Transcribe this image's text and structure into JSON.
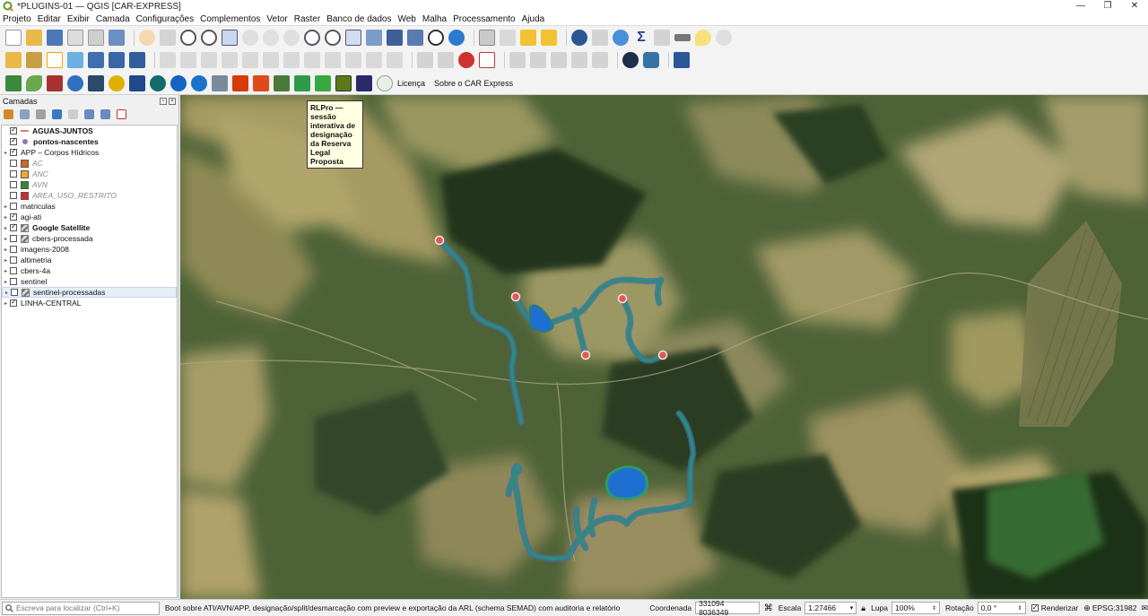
{
  "window": {
    "title": "*PLUGINS-01 — QGIS [CAR-EXPRESS]",
    "controls": [
      "—",
      "❐",
      "✕"
    ]
  },
  "menu": [
    "Projeto",
    "Editar",
    "Exibir",
    "Camada",
    "Configurações",
    "Complementos",
    "Vetor",
    "Raster",
    "Banco de dados",
    "Web",
    "Malha",
    "Processamento",
    "Ajuda"
  ],
  "plugin_toolbar": {
    "license_label": "Licença",
    "about_label": "Sobre o CAR Express"
  },
  "tooltip": {
    "text": "RLPro — sessão interativa de designação da Reserva Legal Proposta"
  },
  "layers_panel": {
    "title": "Camadas",
    "layers": [
      {
        "name": "AGUAS-JUNTOS",
        "checked": true,
        "expandable": false,
        "style": "bold",
        "symbol": "line",
        "color": "#e08080"
      },
      {
        "name": "pontos-nascentes",
        "checked": true,
        "expandable": false,
        "style": "bold",
        "symbol": "point",
        "color": "#8a7bb0"
      },
      {
        "name": "APP – Corpos Hídricos",
        "checked": true,
        "expandable": true,
        "style": "normal",
        "symbol": "none",
        "color": ""
      },
      {
        "name": "AC",
        "checked": false,
        "expandable": false,
        "style": "italic",
        "symbol": "fill",
        "color": "#d2691e"
      },
      {
        "name": "ANC",
        "checked": false,
        "expandable": false,
        "style": "italic",
        "symbol": "fill",
        "color": "#f0a830"
      },
      {
        "name": "AVN",
        "checked": false,
        "expandable": false,
        "style": "italic",
        "symbol": "fill",
        "color": "#2e8b2e"
      },
      {
        "name": "AREA_USO_RESTRITO",
        "checked": false,
        "expandable": false,
        "style": "italic",
        "symbol": "fill",
        "color": "#d62828"
      },
      {
        "name": "matriculas",
        "checked": false,
        "expandable": true,
        "style": "normal",
        "symbol": "none",
        "color": ""
      },
      {
        "name": "agi-ati",
        "checked": true,
        "expandable": true,
        "style": "normal",
        "symbol": "none",
        "color": ""
      },
      {
        "name": "Google Satellite",
        "checked": true,
        "expandable": true,
        "style": "bold",
        "symbol": "raster",
        "color": ""
      },
      {
        "name": "cbers-processada",
        "checked": false,
        "expandable": true,
        "style": "normal",
        "symbol": "raster",
        "color": ""
      },
      {
        "name": "imagens-2008",
        "checked": false,
        "expandable": true,
        "style": "normal",
        "symbol": "none",
        "color": ""
      },
      {
        "name": "altimetria",
        "checked": false,
        "expandable": true,
        "style": "normal",
        "symbol": "none",
        "color": ""
      },
      {
        "name": "cbers-4a",
        "checked": false,
        "expandable": true,
        "style": "normal",
        "symbol": "none",
        "color": ""
      },
      {
        "name": "sentinel",
        "checked": false,
        "expandable": true,
        "style": "normal",
        "symbol": "none",
        "color": ""
      },
      {
        "name": "sentinel-processadas",
        "checked": false,
        "expandable": true,
        "style": "normal",
        "symbol": "raster",
        "color": "",
        "selected": true
      },
      {
        "name": "LINHA-CENTRAL",
        "checked": true,
        "expandable": true,
        "style": "normal",
        "symbol": "none",
        "color": ""
      }
    ]
  },
  "status_bar": {
    "locator_placeholder": "Escreva para localizar (Ctrl+K)",
    "message": "Boot sobre ATI/AVN/APP, designação/split/desmarcação com preview e exportação da ARL (schema SEMAD) com auditoria e relatório",
    "coord_label": "Coordenada",
    "coord_value": "331094 8036349",
    "scale_label": "Escala",
    "scale_value": "1:27466",
    "magnifier_label": "Lupa",
    "magnifier_value": "100%",
    "rotation_label": "Rotação",
    "rotation_value": "0,0 °",
    "render_label": "Renderizar",
    "crs_label": "EPSG:31982"
  },
  "colors": {
    "stream": "#2e7d6a",
    "stream_edge": "#3d6fb0",
    "water": "#1f6fd0",
    "spring": "#e05858"
  }
}
